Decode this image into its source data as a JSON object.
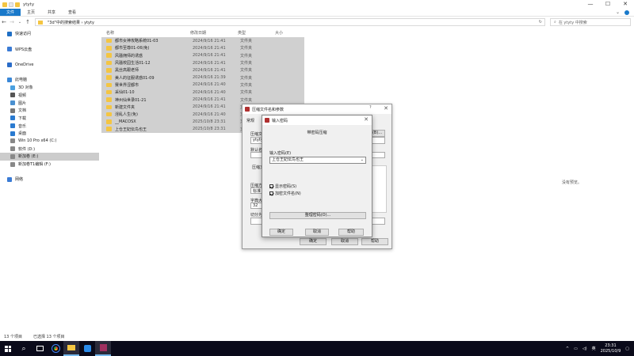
{
  "window": {
    "title": "ytyty",
    "controls": [
      "—",
      "☐",
      "✕"
    ]
  },
  "ribbon": {
    "tabs": [
      "文件",
      "主页",
      "共享",
      "查看"
    ]
  },
  "address": {
    "path": "\"3d\"中的搜索结果  ›  ytyty"
  },
  "search": {
    "placeholder": "在 ytyty 中搜索"
  },
  "nav": {
    "items": [
      {
        "label": "快速访问",
        "icon": "star-icon",
        "color": "#1f6fc5"
      },
      {
        "label": "",
        "icon": "",
        "color": ""
      },
      {
        "label": "WPS云盘",
        "icon": "cloud-icon",
        "color": "#3a7bd5"
      },
      {
        "label": "",
        "icon": "",
        "color": ""
      },
      {
        "label": "OneDrive",
        "icon": "cloud-icon",
        "color": "#2a6cc8"
      },
      {
        "label": "",
        "icon": "",
        "color": ""
      },
      {
        "label": "此电脑",
        "icon": "computer-icon",
        "color": "#3a88d8"
      },
      {
        "label": "3D 对象",
        "icon": "cube-icon",
        "color": "#4aa0e0"
      },
      {
        "label": "视频",
        "icon": "video-icon",
        "color": "#555"
      },
      {
        "label": "图片",
        "icon": "image-icon",
        "color": "#4a90d0"
      },
      {
        "label": "文档",
        "icon": "document-icon",
        "color": "#777"
      },
      {
        "label": "下载",
        "icon": "download-icon",
        "color": "#2a7ad0"
      },
      {
        "label": "音乐",
        "icon": "music-icon",
        "color": "#2a7ad0"
      },
      {
        "label": "桌面",
        "icon": "desktop-icon",
        "color": "#2a7ad0"
      },
      {
        "label": "Win 10 Pro x64 (C:)",
        "icon": "drive-icon",
        "color": "#888"
      },
      {
        "label": "软件 (D:)",
        "icon": "drive-icon",
        "color": "#888"
      },
      {
        "label": "新加卷 (E:)",
        "icon": "drive-icon",
        "color": "#888"
      },
      {
        "label": "新加卷T1编辑 (F:)",
        "icon": "drive-icon",
        "color": "#888"
      },
      {
        "label": "",
        "icon": "",
        "color": ""
      },
      {
        "label": "网络",
        "icon": "network-icon",
        "color": "#3a7bd5"
      }
    ]
  },
  "columns": {
    "name": "名称",
    "date": "修改日期",
    "type": "类型",
    "size": "大小"
  },
  "files": [
    {
      "name": "都市女神攻略系统01-03",
      "date": "2024/9/16 21:41",
      "type": "文件夹"
    },
    {
      "name": "都市至尊01-06(免)",
      "date": "2024/9/16 21:41",
      "type": "文件夹"
    },
    {
      "name": "风骚佣师的诱惑",
      "date": "2024/9/16 21:41",
      "type": "文件夹"
    },
    {
      "name": "风骚校园生活01-12",
      "date": "2024/9/16 21:41",
      "type": "文件夹"
    },
    {
      "name": "黑丝高跟老师",
      "date": "2024/9/16 21:41",
      "type": "文件夹"
    },
    {
      "name": "美人的征服诱惑01-09",
      "date": "2024/9/16 21:39",
      "type": "文件夹"
    },
    {
      "name": "赛世界涩都市",
      "date": "2024/9/16 21:40",
      "type": "文件夹"
    },
    {
      "name": "采仙01-10",
      "date": "2024/9/16 21:40",
      "type": "文件夹"
    },
    {
      "name": "神州仙世录01-21",
      "date": "2024/9/16 21:41",
      "type": "文件夹"
    },
    {
      "name": "新建文件夹",
      "date": "2024/9/16 21:41",
      "type": "文件夹"
    },
    {
      "name": "淫乱人生(免)",
      "date": "2024/9/16 21:40",
      "type": "文件夹"
    },
    {
      "name": "__MACOSX",
      "date": "2025/10/8 23:31",
      "type": "文件夹"
    },
    {
      "name": "上仓王妃伝鸟也王",
      "date": "2025/10/8 23:31",
      "type": "文件夹"
    }
  ],
  "preview": {
    "empty": "没有预览。"
  },
  "status": {
    "count": "13 个项目",
    "selected": "已选择 13 个项目"
  },
  "dialog_main": {
    "title": "压缩文件名和参数",
    "help_mark": "?",
    "tab_general": "常规",
    "label_archive": "压缩文",
    "archive_value": "ytyty.r",
    "browse": "浏览(B)...",
    "label_default": "默认名",
    "label_format": "压缩文",
    "label_method": "压缩方",
    "method_value": "标准",
    "label_dict": "字典大",
    "dict_value": "32",
    "label_split": "切分为",
    "ok": "确定",
    "cancel": "取消",
    "help": "帮助"
  },
  "dialog_pw": {
    "title": "输入密码",
    "heading": "带密码压缩",
    "prompt": "输入密码(E)",
    "password": "上仓王妃伝鸟也王",
    "show_pw": "显示密码(S)",
    "encrypt_names": "加密文件名(N)",
    "organize": "整理密码(O)...",
    "ok": "确定",
    "cancel": "取消",
    "help": "帮助"
  },
  "taskbar": {
    "ime": "英",
    "time": "23:31",
    "date": "2025/10/9"
  }
}
